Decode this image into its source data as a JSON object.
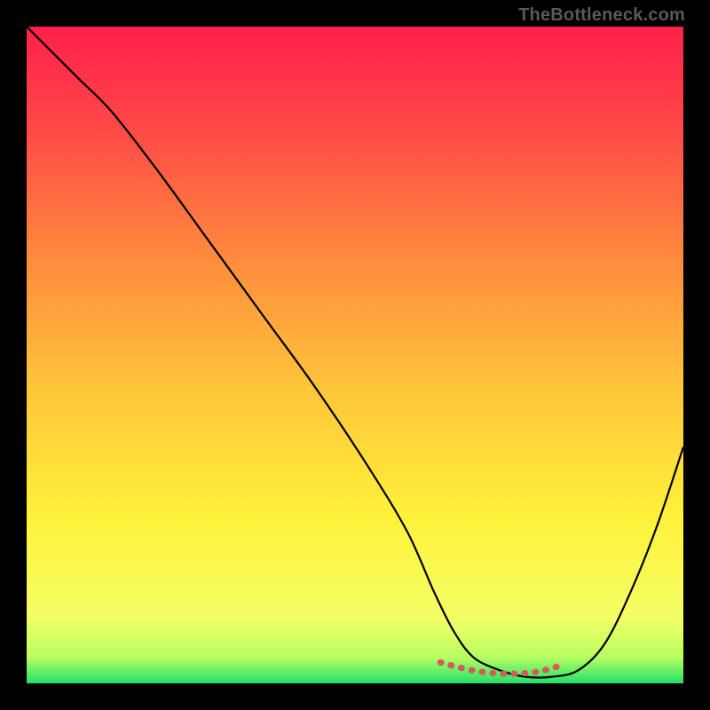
{
  "watermark": "TheBottleneck.com",
  "chart_data": {
    "type": "line",
    "title": "",
    "xlabel": "",
    "ylabel": "",
    "xlim": [
      0,
      100
    ],
    "ylim": [
      0,
      100
    ],
    "grid": false,
    "legend": false,
    "gradient_stops": [
      {
        "offset": 0,
        "color": "#ff1f4b"
      },
      {
        "offset": 15,
        "color": "#ff4747"
      },
      {
        "offset": 35,
        "color": "#ff8a3d"
      },
      {
        "offset": 55,
        "color": "#ffc53a"
      },
      {
        "offset": 75,
        "color": "#fff23a"
      },
      {
        "offset": 90,
        "color": "#f3ff66"
      },
      {
        "offset": 96,
        "color": "#b8ff61"
      },
      {
        "offset": 100,
        "color": "#23e06a"
      }
    ],
    "series": [
      {
        "name": "bottleneck-curve",
        "color": "#000000",
        "x": [
          0,
          4,
          8,
          13,
          20,
          28,
          36,
          44,
          52,
          58,
          62,
          65,
          68,
          72,
          76,
          80,
          84,
          88,
          92,
          96,
          100
        ],
        "y": [
          100,
          96,
          92,
          87,
          78,
          67,
          56,
          45,
          33,
          23,
          14,
          8,
          4,
          2,
          1,
          1,
          2,
          6,
          14,
          24,
          36
        ]
      },
      {
        "name": "optimal-band",
        "color": "#d65a5a",
        "x": [
          63,
          66,
          69,
          72,
          75,
          78,
          81
        ],
        "y": [
          3.2,
          2.4,
          1.8,
          1.5,
          1.5,
          1.8,
          2.6
        ]
      }
    ],
    "annotations": []
  }
}
